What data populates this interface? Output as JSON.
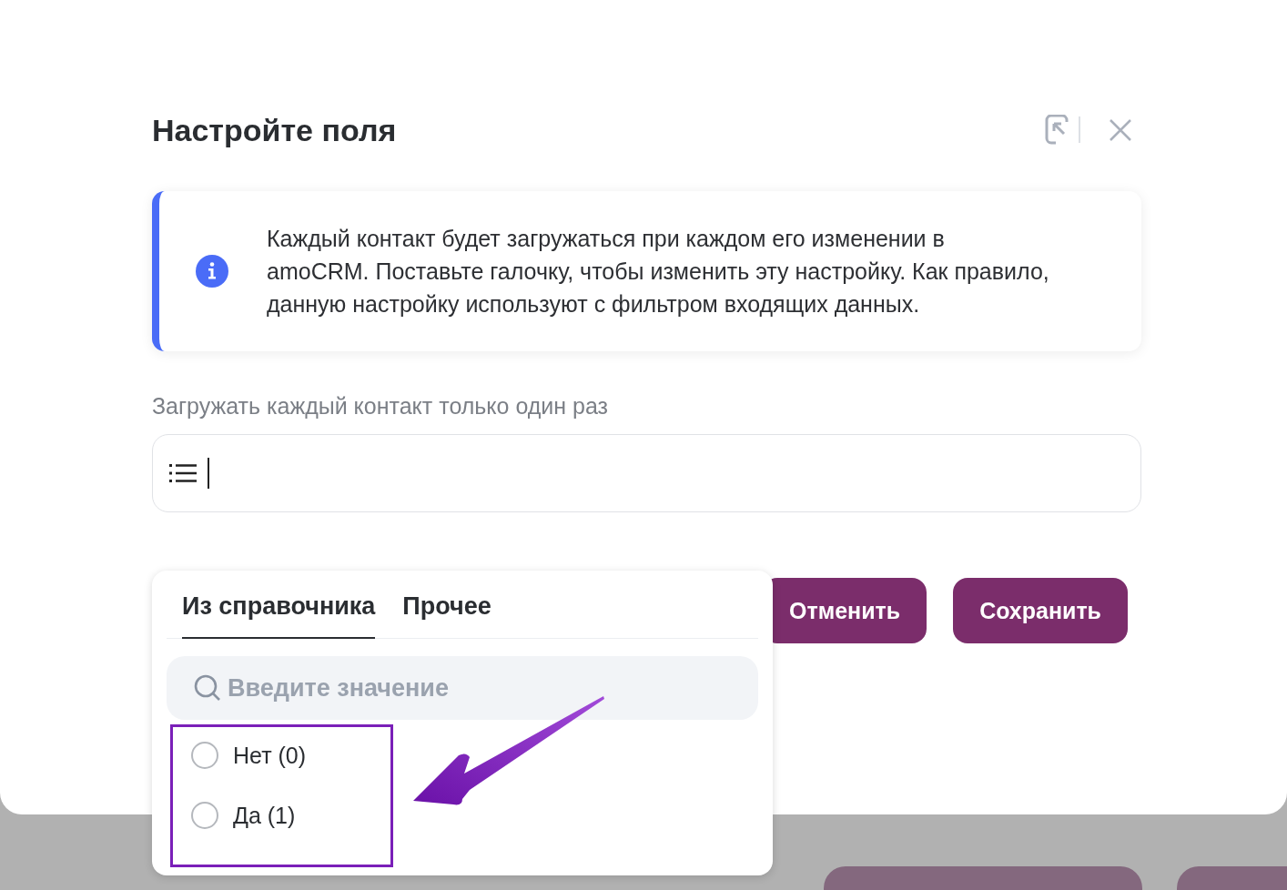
{
  "dialog": {
    "title": "Настройте поля"
  },
  "info": {
    "text": "Каждый контакт будет загружаться при каждом его изменении в amoCRM. Поставьте галочку, чтобы изменить эту настройку. Как правило, данную настройку используют с фильтром входящих данных."
  },
  "field": {
    "label": "Загружать каждый контакт только один раз",
    "focused": true
  },
  "dropdown": {
    "tabs": [
      {
        "label": "Из справочника",
        "selected": true
      },
      {
        "label": "Прочее",
        "selected": false
      }
    ],
    "search": {
      "placeholder": "Введите значение"
    },
    "options": [
      {
        "label": "Нет (0)",
        "selected": false
      },
      {
        "label": "Да (1)",
        "selected": false
      }
    ]
  },
  "buttons": [
    {
      "label": "Отменить"
    },
    {
      "label": "Сохранить"
    }
  ]
}
